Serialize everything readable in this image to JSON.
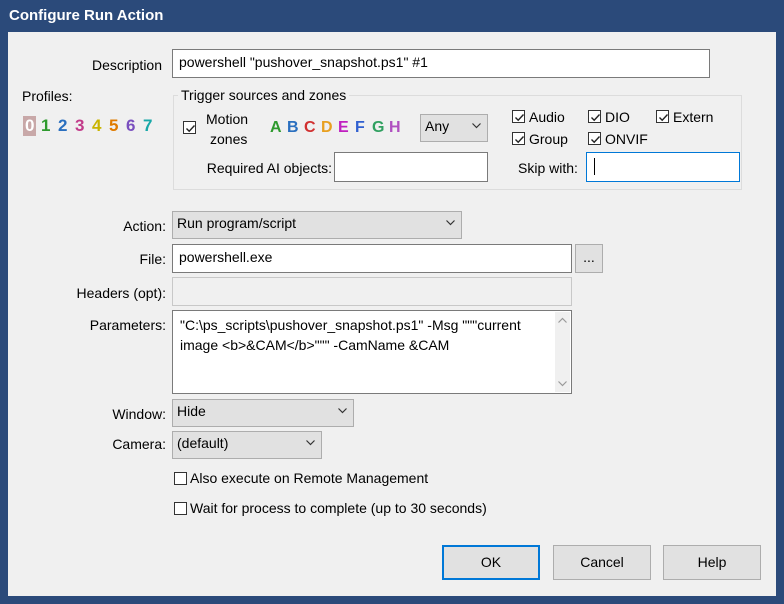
{
  "window": {
    "title": "Configure Run Action"
  },
  "description": {
    "label": "Description",
    "value": "powershell \"pushover_snapshot.ps1\" #1"
  },
  "profiles": {
    "label": "Profiles:",
    "items": [
      "0",
      "1",
      "2",
      "3",
      "4",
      "5",
      "6",
      "7"
    ],
    "colors": [
      "#8a8a8a",
      "#2e9a2e",
      "#2a6fbf",
      "#c23b8a",
      "#c9b400",
      "#e07b00",
      "#7a4fbf",
      "#18a8a8"
    ]
  },
  "trigger": {
    "group_title": "Trigger sources and zones",
    "motion_label_1": "Motion",
    "motion_label_2": "zones",
    "zones": [
      "A",
      "B",
      "C",
      "D",
      "E",
      "F",
      "G",
      "H"
    ],
    "zone_colors": [
      "#2e9a2e",
      "#2a6fbf",
      "#d13030",
      "#e8a020",
      "#c020c0",
      "#3060d0",
      "#30a060",
      "#b050c0"
    ],
    "zone_mode": "Any",
    "audio": "Audio",
    "dio": "DIO",
    "extern": "Extern",
    "group": "Group",
    "onvif": "ONVIF",
    "required_ai_label": "Required AI objects:",
    "required_ai_value": "",
    "skip_with_label": "Skip with:",
    "skip_with_value": ""
  },
  "action": {
    "label": "Action:",
    "value": "Run program/script"
  },
  "file": {
    "label": "File:",
    "value": "powershell.exe",
    "browse": "..."
  },
  "headers": {
    "label": "Headers (opt):",
    "value": ""
  },
  "parameters": {
    "label": "Parameters:",
    "line1": "\"C:\\ps_scripts\\pushover_snapshot.ps1\" -Msg \"\"\"current",
    "line2": "image <b>&CAM</b>\"\"\" -CamName &CAM"
  },
  "window_mode": {
    "label": "Window:",
    "value": "Hide"
  },
  "camera": {
    "label": "Camera:",
    "value": "(default)"
  },
  "options": {
    "remote": "Also execute on Remote Management",
    "wait": "Wait for process to complete (up to 30 seconds)"
  },
  "buttons": {
    "ok": "OK",
    "cancel": "Cancel",
    "help": "Help"
  }
}
